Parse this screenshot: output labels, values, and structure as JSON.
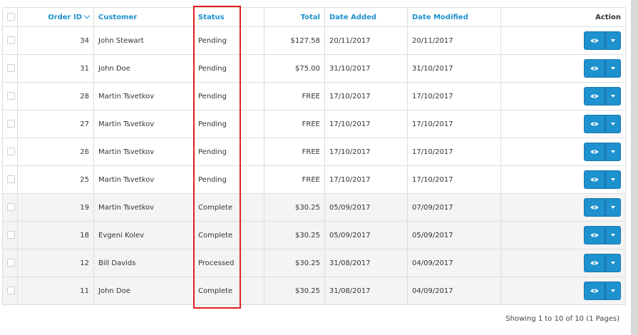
{
  "table": {
    "headers": {
      "order_id": "Order ID",
      "customer": "Customer",
      "status": "Status",
      "total": "Total",
      "date_added": "Date Added",
      "date_modified": "Date Modified",
      "action": "Action"
    },
    "sort": {
      "column": "order_id",
      "direction": "desc",
      "icon": "chevron-down-icon"
    },
    "rows": [
      {
        "order_id": "34",
        "customer": "John Stewart",
        "status": "Pending",
        "total": "$127.58",
        "date_added": "20/11/2017",
        "date_modified": "20/11/2017"
      },
      {
        "order_id": "31",
        "customer": "John Doe",
        "status": "Pending",
        "total": "$75.00",
        "date_added": "31/10/2017",
        "date_modified": "31/10/2017"
      },
      {
        "order_id": "28",
        "customer": "Martin Tsvetkov",
        "status": "Pending",
        "total": "FREE",
        "date_added": "17/10/2017",
        "date_modified": "17/10/2017"
      },
      {
        "order_id": "27",
        "customer": "Martin Tsvetkov",
        "status": "Pending",
        "total": "FREE",
        "date_added": "17/10/2017",
        "date_modified": "17/10/2017"
      },
      {
        "order_id": "26",
        "customer": "Martin Tsvetkov",
        "status": "Pending",
        "total": "FREE",
        "date_added": "17/10/2017",
        "date_modified": "17/10/2017"
      },
      {
        "order_id": "25",
        "customer": "Martin Tsvetkov",
        "status": "Pending",
        "total": "FREE",
        "date_added": "17/10/2017",
        "date_modified": "17/10/2017"
      },
      {
        "order_id": "19",
        "customer": "Martin Tsvetkov",
        "status": "Complete",
        "total": "$30.25",
        "date_added": "05/09/2017",
        "date_modified": "07/09/2017"
      },
      {
        "order_id": "18",
        "customer": "Evgeni Kolev",
        "status": "Complete",
        "total": "$30.25",
        "date_added": "05/09/2017",
        "date_modified": "05/09/2017"
      },
      {
        "order_id": "12",
        "customer": "Bill Davids",
        "status": "Processed",
        "total": "$30.25",
        "date_added": "31/08/2017",
        "date_modified": "04/09/2017"
      },
      {
        "order_id": "11",
        "customer": "John Doe",
        "status": "Complete",
        "total": "$30.25",
        "date_added": "31/08/2017",
        "date_modified": "04/09/2017"
      }
    ]
  },
  "pagination": {
    "summary": "Showing 1 to 10 of 10 (1 Pages)"
  },
  "colors": {
    "accent": "#1e91cf",
    "highlight_box": "#e01e1e",
    "row_alt": "#f4f4f4"
  },
  "icons": {
    "view": "eye-icon",
    "dropdown": "caret-down-icon"
  }
}
